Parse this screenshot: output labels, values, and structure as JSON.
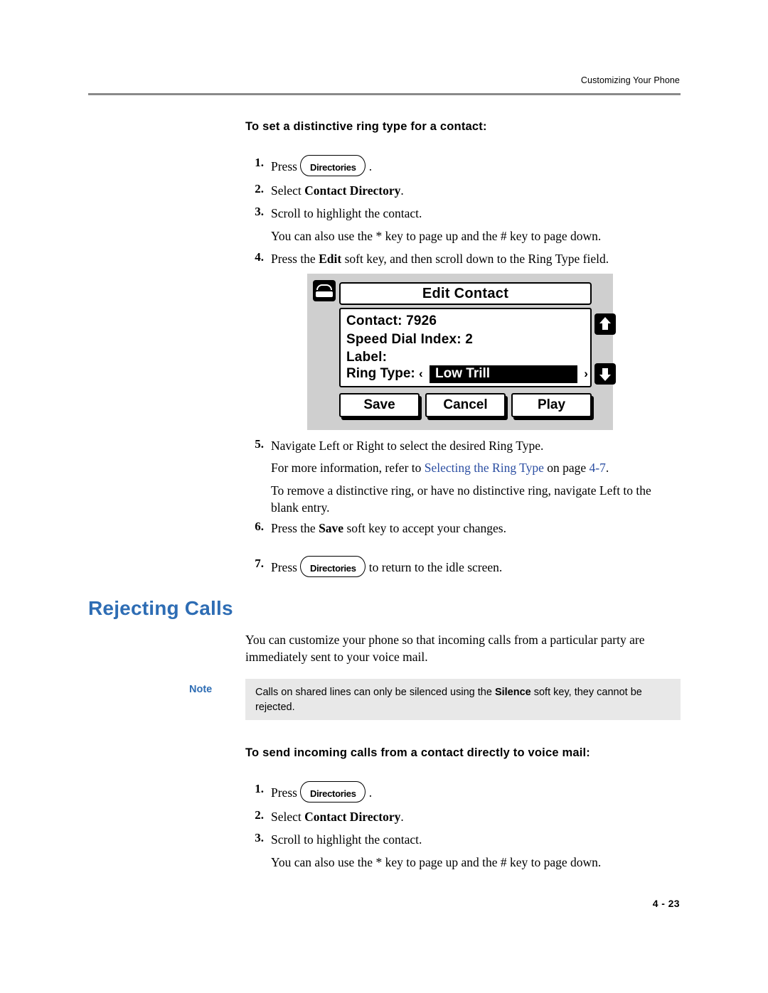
{
  "header": {
    "running_head": "Customizing Your Phone"
  },
  "section1": {
    "heading": "To set a distinctive ring type for a contact:",
    "steps": [
      {
        "num": "1.",
        "pre": "Press",
        "key": "Directories",
        "post": "."
      },
      {
        "num": "2.",
        "text_prefix": "Select ",
        "text_bold": "Contact Directory",
        "text_suffix": "."
      },
      {
        "num": "3.",
        "text": "Scroll to highlight the contact."
      },
      {
        "num": "",
        "text": "You can also use the * key to page up and the # key to page down."
      },
      {
        "num": "4.",
        "pre": "Press the ",
        "bold": "Edit",
        "post": " soft key, and then scroll down to the Ring Type field."
      },
      {
        "num": "5.",
        "text": "Navigate Left or Right to select the desired Ring Type."
      },
      {
        "num": "",
        "pre": "For more information, refer to ",
        "link": "Selecting the Ring Type",
        "mid": " on page ",
        "link2": "4-7",
        "post": "."
      },
      {
        "num": "",
        "text": "To remove a distinctive ring, or have no distinctive ring, navigate Left to the blank entry."
      },
      {
        "num": "6.",
        "pre": "Press the ",
        "bold": "Save",
        "post": " soft key to accept your changes."
      },
      {
        "num": "7.",
        "pre": "Press",
        "key": "Directories",
        "post": "to return to the idle screen."
      }
    ]
  },
  "lcd": {
    "title": "Edit Contact",
    "phone_icon": "phone-icon",
    "line1": "Contact: 7926",
    "line2": "Speed Dial Index: 2",
    "line3": "Label:",
    "ring_type_label": "Ring Type:",
    "ring_type_left_arrow": "‹",
    "ring_type_value": "Low Trill",
    "ring_type_right_arrow": "›",
    "up_icon": "arrow-up-icon",
    "down_icon": "arrow-down-icon",
    "softkeys": [
      "Save",
      "Cancel",
      "Play"
    ]
  },
  "rejecting": {
    "heading": "Rejecting Calls",
    "paragraph": "You can customize your phone so that incoming calls from a particular party are immediately sent to your voice mail.",
    "note_label": "Note",
    "note_prefix": "Calls on shared lines can only be silenced using the ",
    "note_bold": "Silence",
    "note_suffix": " soft key, they cannot be rejected."
  },
  "section2": {
    "heading": "To send incoming calls from a contact directly to voice mail:",
    "steps": [
      {
        "num": "1.",
        "pre": "Press",
        "key": "Directories",
        "post": "."
      },
      {
        "num": "2.",
        "text_prefix": "Select ",
        "text_bold": "Contact Directory",
        "text_suffix": "."
      },
      {
        "num": "3.",
        "text": "Scroll to highlight the contact."
      },
      {
        "num": "",
        "text": "You can also use the * key to page up and the # key to page down."
      }
    ]
  },
  "footer": {
    "page": "4 - 23"
  }
}
